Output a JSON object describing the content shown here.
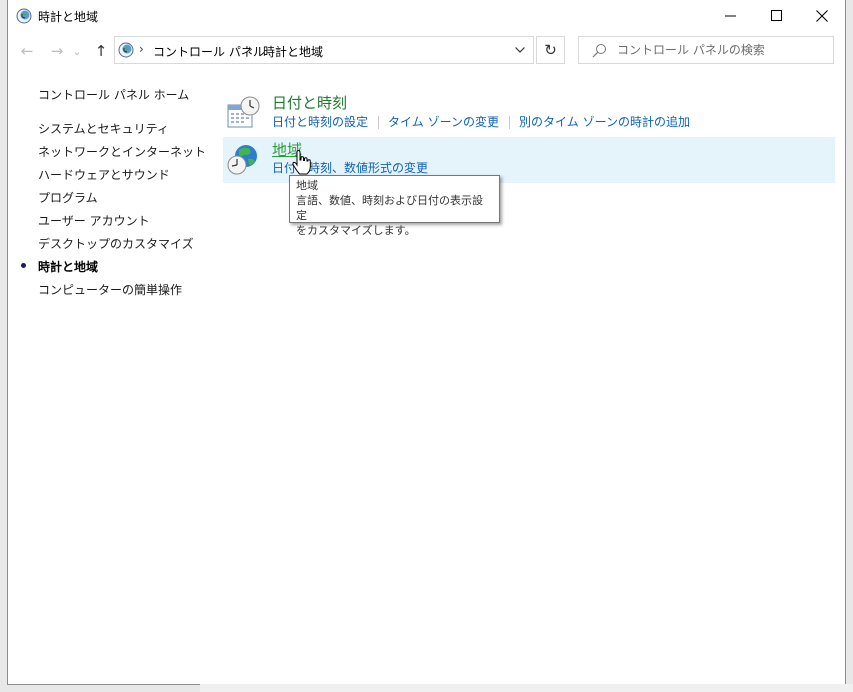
{
  "window": {
    "title": "時計と地域",
    "minimize": "—",
    "maximize": "☐",
    "close": "✕"
  },
  "nav": {
    "back": "←",
    "forward": "→",
    "recent": "⌄",
    "up": "↑"
  },
  "address": {
    "crumbs": [
      "コントロール パネル",
      "時計と地域"
    ],
    "separator": "›",
    "refresh": "↻"
  },
  "search": {
    "placeholder": "コントロール パネルの検索"
  },
  "sidebar": {
    "home": "コントロール パネル ホーム",
    "items": [
      {
        "label": "システムとセキュリティ"
      },
      {
        "label": "ネットワークとインターネット"
      },
      {
        "label": "ハードウェアとサウンド"
      },
      {
        "label": "プログラム"
      },
      {
        "label": "ユーザー アカウント"
      },
      {
        "label": "デスクトップのカスタマイズ"
      },
      {
        "label": "時計と地域"
      },
      {
        "label": "コンピューターの簡単操作"
      }
    ]
  },
  "categories": [
    {
      "title": "日付と時刻",
      "icon": "calendar-clock-icon",
      "links": [
        "日付と時刻の設定",
        "タイム ゾーンの変更",
        "別のタイム ゾーンの時計の追加"
      ]
    },
    {
      "title": "地域",
      "icon": "globe-clock-icon",
      "links": [
        "日付、時刻、数値形式の変更"
      ]
    }
  ],
  "tooltip": {
    "line1": "地域",
    "line2": "言語、数値、時刻および日付の表示設定",
    "line3": "をカスタマイズします。"
  },
  "colors": {
    "category_title": "#1e7a2e",
    "link": "#0f62b5",
    "hover_bg": "#e5f3fb"
  }
}
